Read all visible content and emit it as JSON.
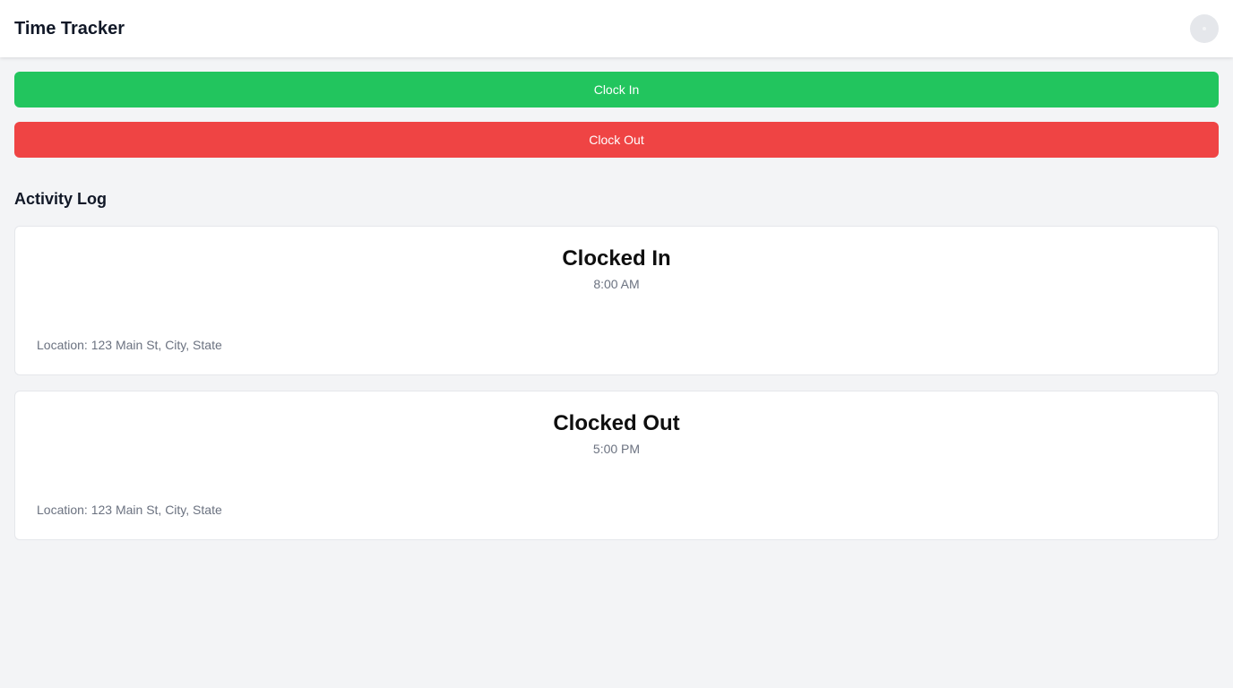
{
  "header": {
    "title": "Time Tracker",
    "avatar_icon": "user-avatar-icon"
  },
  "actions": {
    "clock_in_label": "Clock In",
    "clock_out_label": "Clock Out",
    "clock_in_color": "#22c55e",
    "clock_out_color": "#ef4444"
  },
  "activity": {
    "title": "Activity Log",
    "entries": [
      {
        "status": "Clocked In",
        "time": "8:00 AM",
        "location": "Location: 123 Main St, City, State"
      },
      {
        "status": "Clocked Out",
        "time": "5:00 PM",
        "location": "Location: 123 Main St, City, State"
      }
    ]
  }
}
